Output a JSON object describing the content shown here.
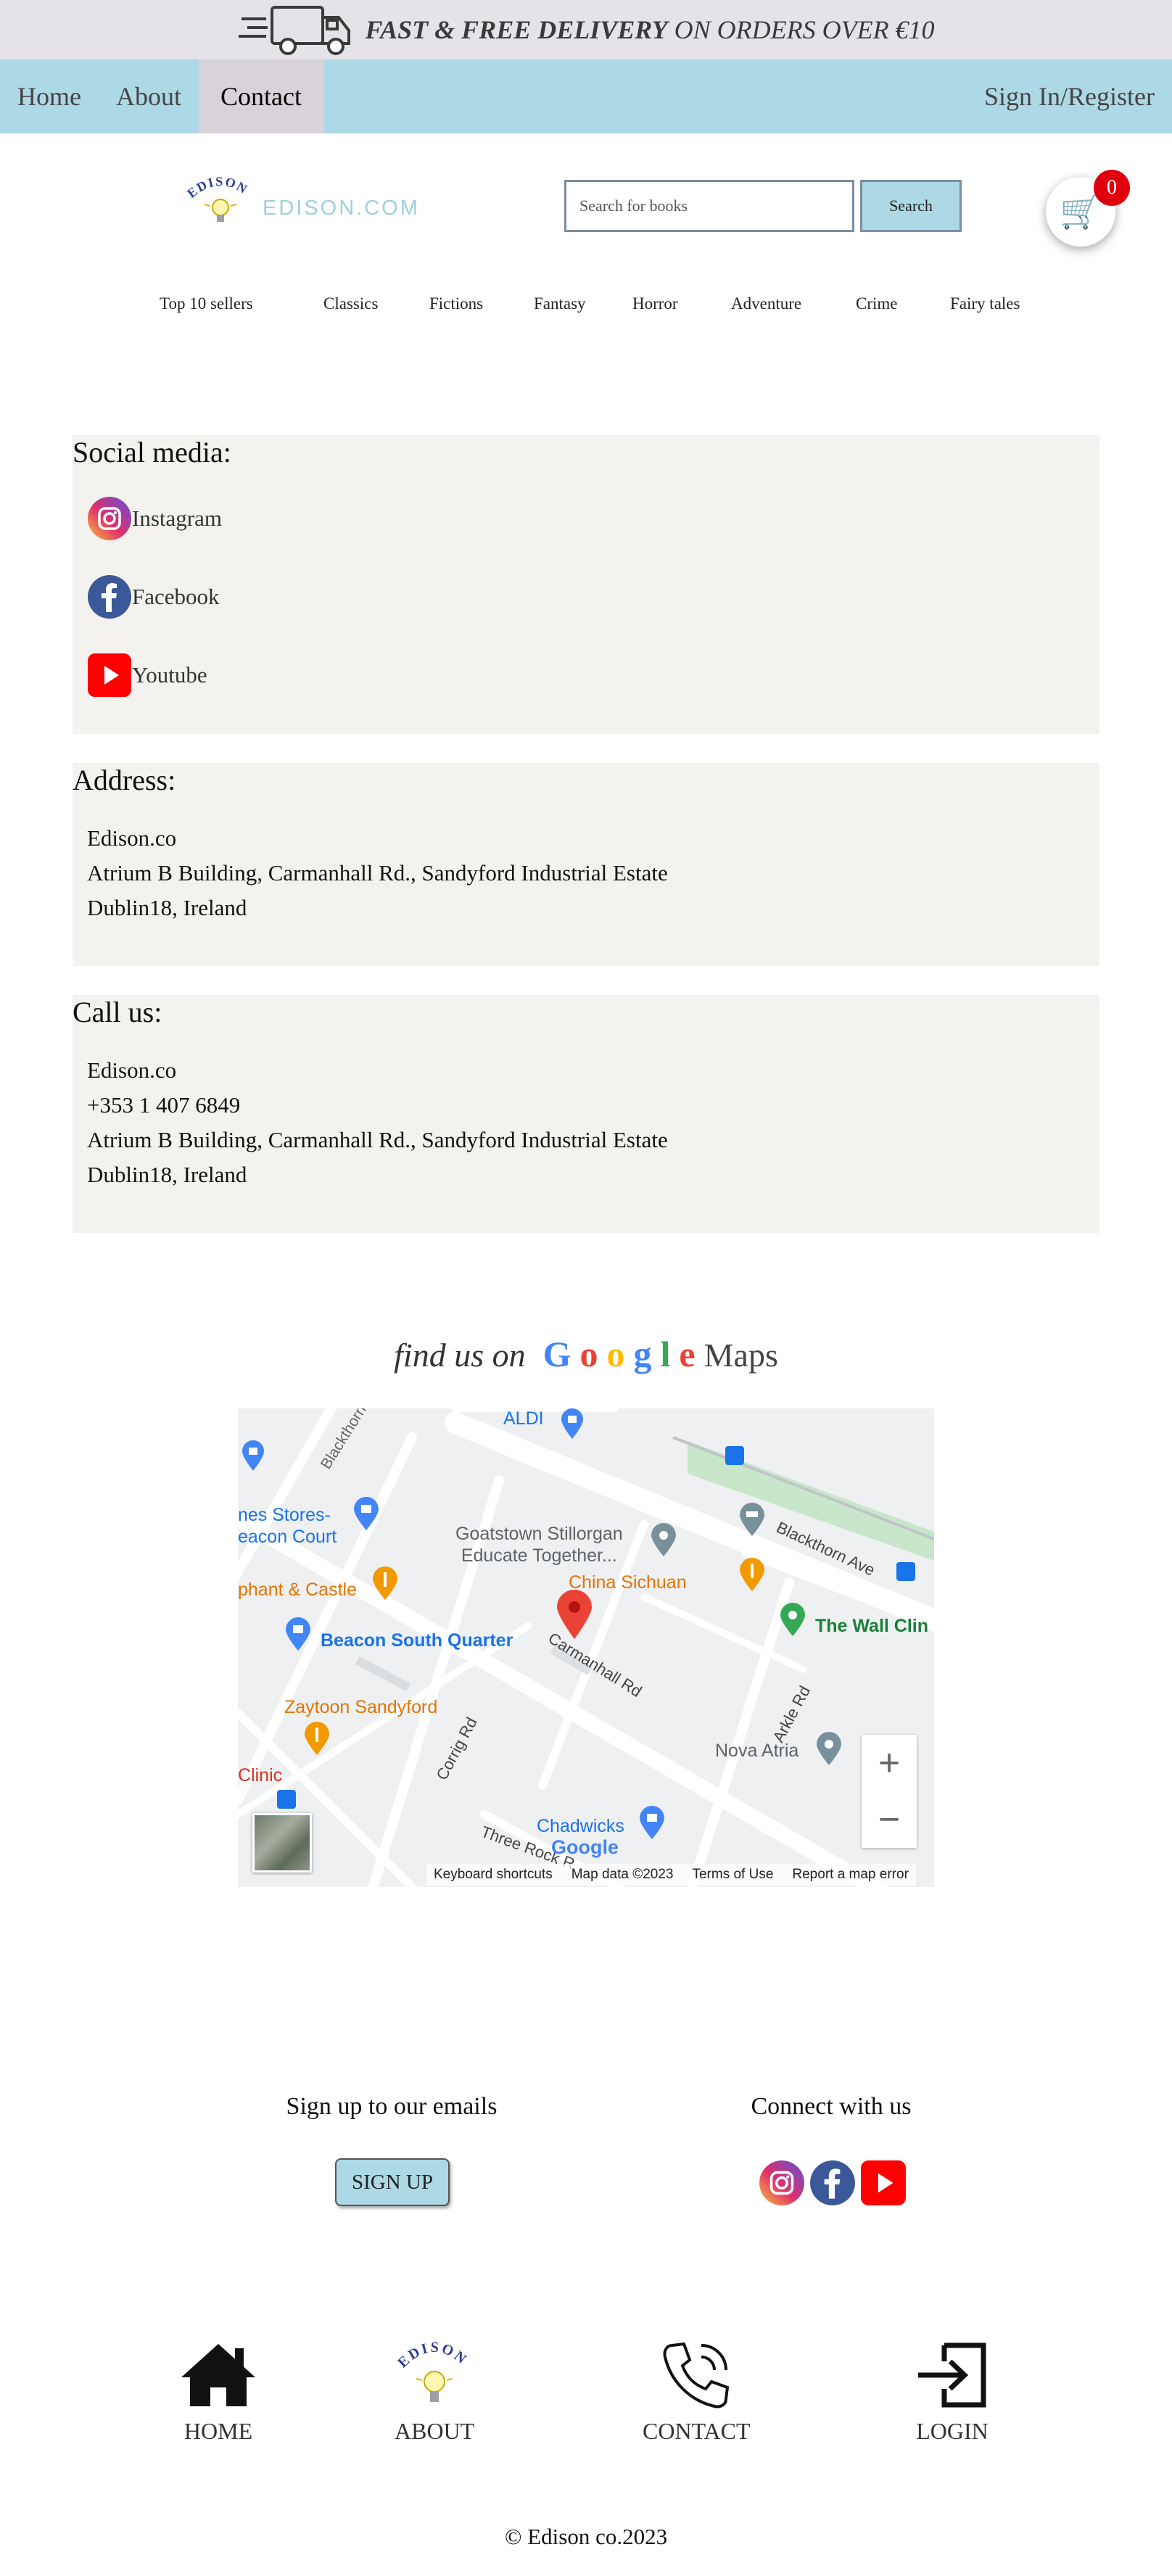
{
  "promo": {
    "bold": "FAST & FREE DELIVERY",
    "rest": " ON ORDERS OVER €10",
    "icon": "delivery-truck-icon"
  },
  "nav": {
    "home": "Home",
    "about": "About",
    "contact": "Contact",
    "signin": "Sign In/Register",
    "active": "Contact"
  },
  "header": {
    "logo_arc": "EDISON",
    "logo_text": "EDISON.COM",
    "search_placeholder": "Search for books",
    "search_button": "Search",
    "cart_count": "0",
    "cart_icon": "shopping-cart-icon"
  },
  "categories": [
    "Top 10 sellers",
    "Classics",
    "Fictions",
    "Fantasy",
    "Horror",
    "Adventure",
    "Crime",
    "Fairy tales"
  ],
  "social": {
    "title": "Social media:",
    "items": [
      {
        "label": "Instagram",
        "icon": "instagram-icon"
      },
      {
        "label": "Facebook",
        "icon": "facebook-icon"
      },
      {
        "label": "Youtube",
        "icon": "youtube-icon"
      }
    ]
  },
  "address": {
    "title": "Address:",
    "lines": [
      "Edison.co",
      "Atrium B Building, Carmanhall Rd., Sandyford Industrial Estate",
      "Dublin18, Ireland"
    ]
  },
  "call": {
    "title": "Call us:",
    "lines": [
      "Edison.co",
      "+353 1 407 6849",
      "Atrium B Building, Carmanhall Rd., Sandyford Industrial Estate",
      "Dublin18, Ireland"
    ]
  },
  "maps_heading": {
    "find": "find us on",
    "google_letters": [
      "G",
      "o",
      "o",
      "g",
      "l",
      "e"
    ],
    "maps": "Maps"
  },
  "map": {
    "places": {
      "aldi": "ALDI",
      "dunnes": "nes Stores-\neacon Court",
      "goatstown": "Goatstown Stillorgan\nEducate Together...",
      "blackthorn_ave": "Blackthorn Ave",
      "blackthorn_dr": "Blackthorn D",
      "elephant": "phant & Castle",
      "china": "China Sichuan",
      "wall": "The Wall Clin",
      "beacon": "Beacon South Quarter",
      "carmanhall": "Carmanhall Rd",
      "zaytoon": "Zaytoon Sandyford",
      "corrig": "Corrig Rd",
      "arkle": "Arkle Rd",
      "nova": "Nova Atria",
      "clinic": "Clinic",
      "chadwicks": "Chadwicks",
      "three_rock": "Three Rock R",
      "google": "Google"
    },
    "zoom_in": "+",
    "zoom_out": "−",
    "attribution": [
      "Keyboard shortcuts",
      "Map data ©2023",
      "Terms of Use",
      "Report a map error"
    ]
  },
  "footer": {
    "signup_heading": "Sign up to our emails",
    "signup_button": "SIGN UP",
    "connect_heading": "Connect with us",
    "bottom_nav": [
      {
        "label": "HOME",
        "icon": "home-icon"
      },
      {
        "label": "ABOUT",
        "icon": "edison-logo-icon"
      },
      {
        "label": "CONTACT",
        "icon": "phone-icon"
      },
      {
        "label": "LOGIN",
        "icon": "login-icon"
      }
    ],
    "copyright": "© Edison co.2023"
  },
  "colors": {
    "nav_bg": "#add8e6",
    "promo_bg": "#e6e3e8",
    "panel_bg": "#f3f2ee",
    "badge": "#e0000d"
  }
}
